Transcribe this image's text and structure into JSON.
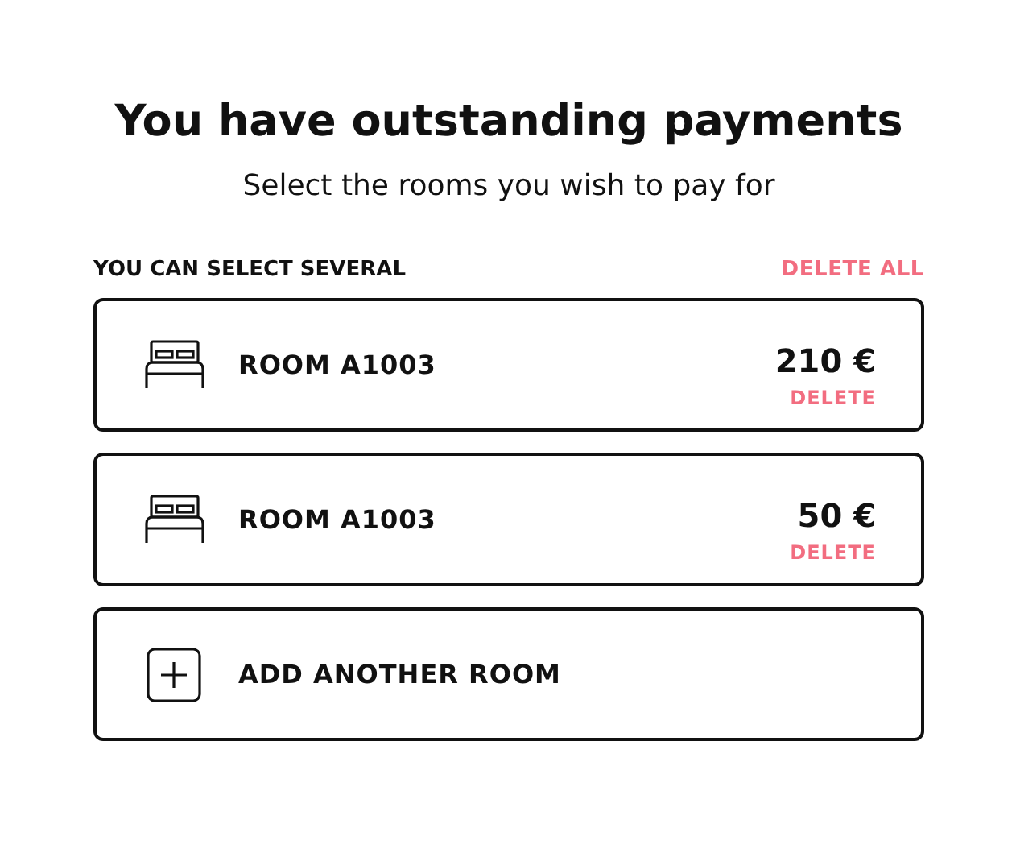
{
  "title": "You have outstanding payments",
  "subtitle": "Select the rooms you wish to pay for",
  "list_header": {
    "label": "YOU CAN SELECT SEVERAL",
    "action": "DELETE ALL"
  },
  "rooms": [
    {
      "label": "ROOM **A1003**",
      "price": "210 €",
      "action": "DELETE"
    },
    {
      "label": "ROOM **A1003**",
      "price": "50 €",
      "action": "DELETE"
    }
  ],
  "add_button": {
    "label": "ADD ANOTHER ROOM"
  }
}
